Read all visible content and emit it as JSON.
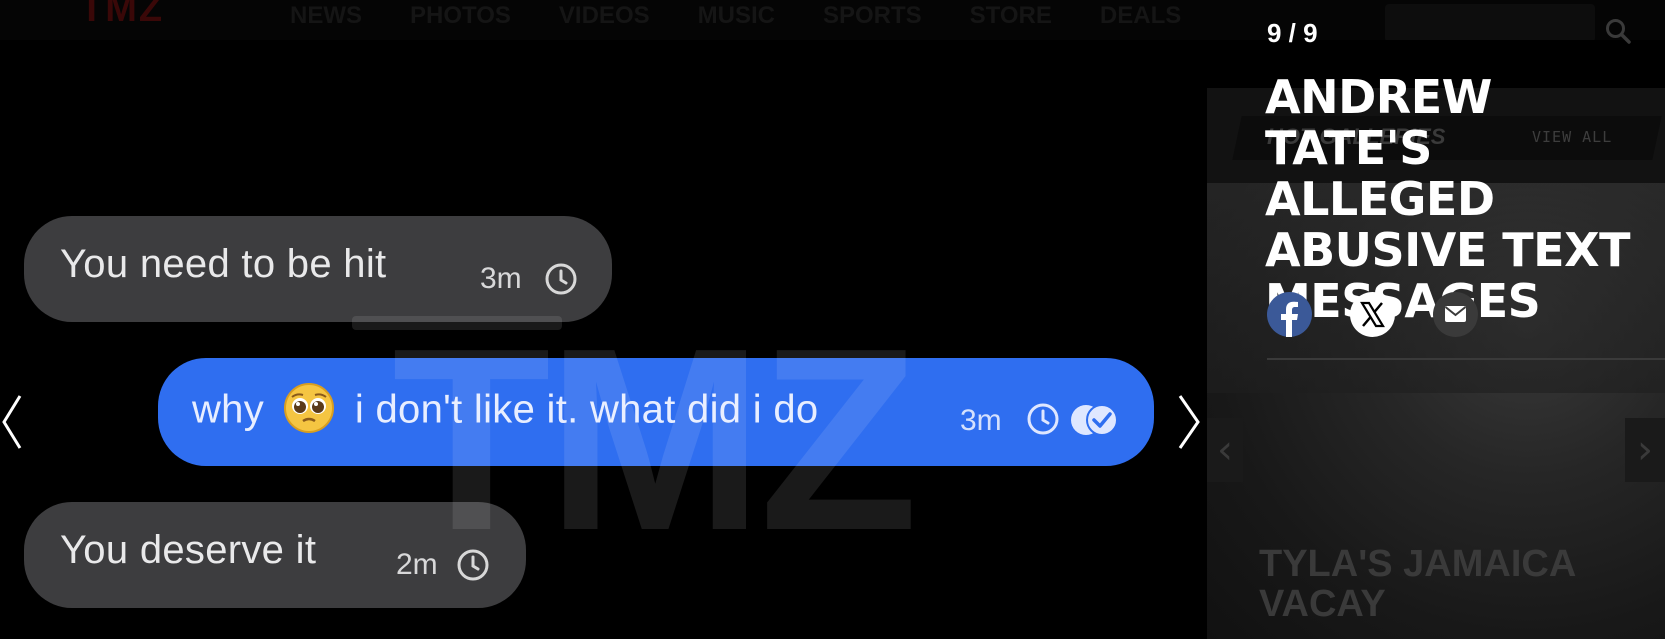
{
  "background_page": {
    "logo": "TMZ",
    "nav_items": [
      "NEWS",
      "PHOTOS",
      "VIDEOS",
      "MUSIC",
      "SPORTS",
      "STORE",
      "DEALS"
    ],
    "rail": {
      "header": "HOT GALLERIES",
      "view_all": "VIEW ALL",
      "caption": "TYLA'S JAMAICA VACAY"
    }
  },
  "gallery": {
    "counter": "9 / 9",
    "title": "ANDREW TATE'S ALLEGED ABUSIVE TEXT MESSAGES",
    "watermark": "TMZ",
    "messages": [
      {
        "text": "You need to be hit",
        "time": "3m",
        "side": "received"
      },
      {
        "text_before": "why",
        "emoji": "pleading-face",
        "text_after": "i don't like it. what did i do",
        "time": "3m",
        "side": "sent"
      },
      {
        "text": "You deserve it",
        "time": "2m",
        "side": "received"
      }
    ]
  },
  "share": {
    "icons": [
      "facebook-icon",
      "x-icon",
      "email-icon"
    ]
  },
  "colors": {
    "sent_bubble": "#2f6ef0",
    "received_bubble": "#3d3d3f",
    "facebook": "#3b5998",
    "background": "#000000"
  }
}
